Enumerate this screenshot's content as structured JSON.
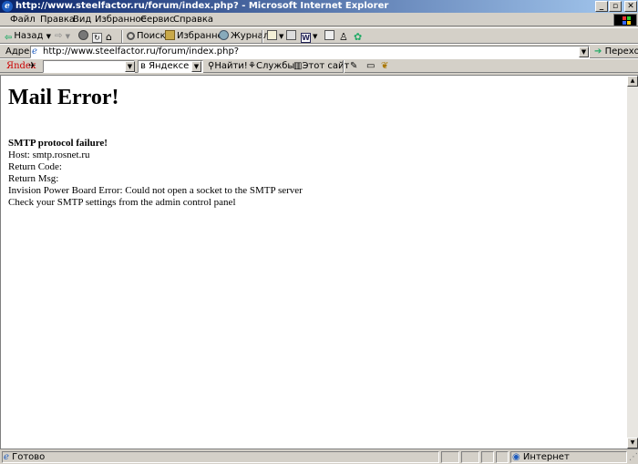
{
  "window": {
    "title": "http://www.steelfactor.ru/forum/index.php? - Microsoft Internet Explorer",
    "minimize": "_",
    "restore": "▫",
    "close": "✕"
  },
  "menu": {
    "items": [
      "Файл",
      "Правка",
      "Вид",
      "Избранное",
      "Сервис",
      "Справка"
    ]
  },
  "toolbar": {
    "back": "Назад",
    "search": "Поиск",
    "favorites": "Избранное",
    "history": "Журнал"
  },
  "address": {
    "label": "Адрес",
    "url": "http://www.steelfactor.ru/forum/index.php?",
    "go": "Переход"
  },
  "yandex": {
    "logo": "Яndex",
    "scope": "в Яндексе",
    "find": "Найти!",
    "services": "Службы",
    "this_site": "Этот сайт"
  },
  "page": {
    "heading": "Mail Error!",
    "lines": [
      "SMTP protocol failure!",
      "Host: smtp.rosnet.ru",
      "Return Code:",
      "Return Msg:",
      "Invision Power Board Error: Could not open a socket to the SMTP server",
      "Check your SMTP settings from the admin control panel"
    ]
  },
  "status": {
    "text": "Готово",
    "zone": "Интернет"
  },
  "colors": {
    "titlebar_start": "#0a246a",
    "titlebar_end": "#a6caf0",
    "chrome": "#d4d0c8"
  }
}
